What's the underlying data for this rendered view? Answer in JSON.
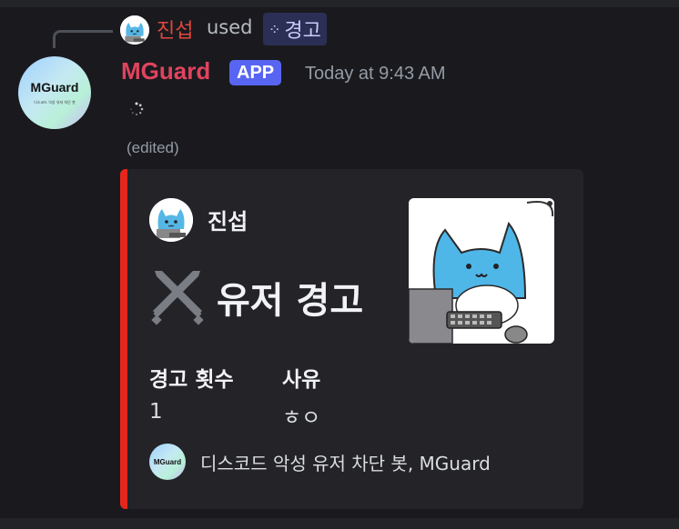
{
  "reply": {
    "username": "진섭",
    "used_text": "used",
    "command": "경고",
    "command_icon": "app-command-icon"
  },
  "message": {
    "author": "MGuard",
    "badge": "APP",
    "timestamp": "Today at 9:43 AM",
    "edited_label": "(edited)",
    "avatar": {
      "logo_text": "MGuard",
      "subtitle": "디스코드 악성 유저 차단 봇"
    }
  },
  "embed": {
    "accent_color": "#e5271b",
    "author_name": "진섭",
    "title": "유저 경고",
    "title_icon": "crossed-swords-icon",
    "fields": [
      {
        "name": "경고 횟수",
        "value": "1"
      },
      {
        "name": "사유",
        "value": "ㅎㅇ"
      }
    ],
    "footer": {
      "icon_text": "MGuard",
      "text": "디스코드 악성 유저 차단 봇, MGuard"
    }
  },
  "colors": {
    "background": "#1a1a1e",
    "embed_bg": "#232328",
    "author_color": "#e0435f",
    "badge_color": "#5865f2"
  }
}
